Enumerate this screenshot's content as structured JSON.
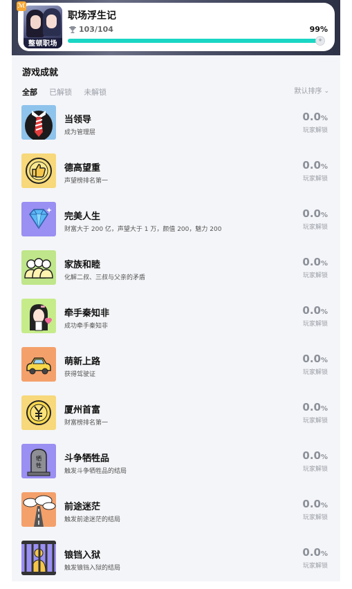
{
  "header": {
    "game_title": "职场浮生记",
    "cover_text": "整顿职场",
    "trophy_count": "103/104",
    "percent_text": "99%",
    "progress_fraction": 0.99
  },
  "achievements_section": {
    "title": "游戏成就",
    "tabs": [
      "全部",
      "已解锁",
      "未解锁"
    ],
    "active_tab": "全部",
    "sort_label": "默认排序"
  },
  "rate_label": "玩家解锁",
  "achievements": [
    {
      "title": "当领导",
      "desc": "成为管理层",
      "rate": "0.0",
      "unit": "%",
      "icon": "tie-icon",
      "bg": "#8ec3ec"
    },
    {
      "title": "德高望重",
      "desc": "声望榜排名第一",
      "rate": "0.0",
      "unit": "%",
      "icon": "thumbs-up-icon",
      "bg": "#f7d87a"
    },
    {
      "title": "完美人生",
      "desc": "财富大于 200 亿，声望大于 1 万，颜值 200，魅力 200",
      "rate": "0.0",
      "unit": "%",
      "icon": "diamond-icon",
      "bg": "#9a8ff2"
    },
    {
      "title": "家族和睦",
      "desc": "化解二叔、三叔与父亲的矛盾",
      "rate": "0.0",
      "unit": "%",
      "icon": "family-icon",
      "bg": "#bfe68a"
    },
    {
      "title": "牵手秦知非",
      "desc": "成功牵手秦知非",
      "rate": "0.0",
      "unit": "%",
      "icon": "girl-heart-icon",
      "bg": "#c6ec8a"
    },
    {
      "title": "萌新上路",
      "desc": "获得驾驶证",
      "rate": "0.0",
      "unit": "%",
      "icon": "car-icon",
      "bg": "#f4a06a"
    },
    {
      "title": "厦州首富",
      "desc": "财富榜排名第一",
      "rate": "0.0",
      "unit": "%",
      "icon": "yuan-coin-icon",
      "bg": "#f7d87a"
    },
    {
      "title": "斗争牺牲品",
      "desc": "触发斗争牺牲品的结局",
      "rate": "0.0",
      "unit": "%",
      "icon": "tombstone-icon",
      "bg": "#9a8ff2"
    },
    {
      "title": "前途迷茫",
      "desc": "触发前途迷茫的结局",
      "rate": "0.0",
      "unit": "%",
      "icon": "foggy-road-icon",
      "bg": "#f4a06a"
    },
    {
      "title": "锒铛入狱",
      "desc": "触发锒铛入狱的结局",
      "rate": "0.0",
      "unit": "%",
      "icon": "prison-icon",
      "bg": "#9a8ff2"
    }
  ],
  "tombstone_text": "牺牲"
}
